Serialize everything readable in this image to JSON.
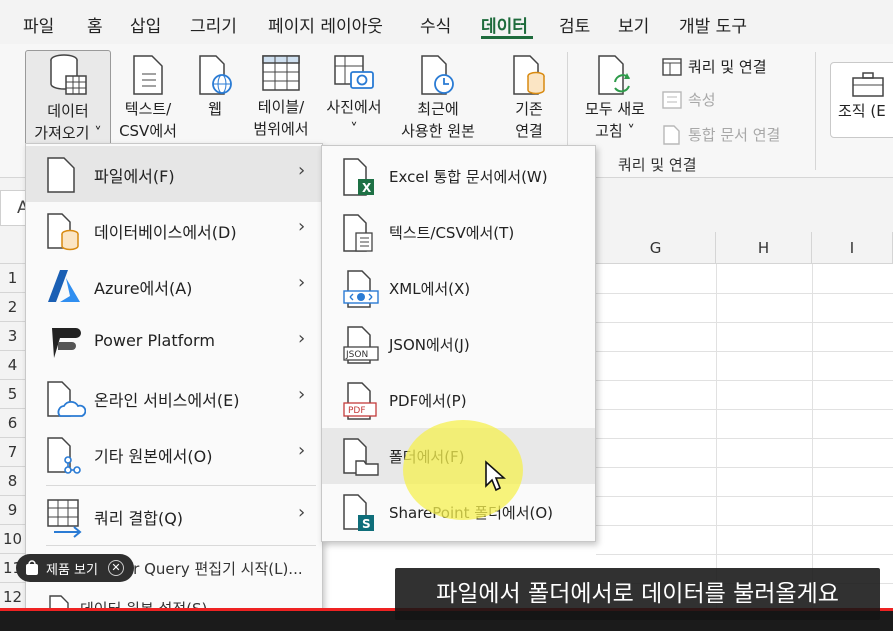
{
  "ribbon_tabs": [
    "파일",
    "홈",
    "삽입",
    "그리기",
    "페이지 레이아웃",
    "수식",
    "데이터",
    "검토",
    "보기",
    "개발 도구"
  ],
  "active_tab": "데이터",
  "ribbon": {
    "get_data": [
      "데이터",
      "가져오기 ˅"
    ],
    "text_csv": [
      "텍스트/",
      "CSV에서"
    ],
    "web": [
      "웹"
    ],
    "table_range": [
      "테이블/",
      "범위에서"
    ],
    "from_picture": [
      "사진에서",
      "˅"
    ],
    "recent_sources": [
      "최근에",
      "사용한 원본"
    ],
    "existing_connections": [
      "기존",
      "연결"
    ],
    "refresh_all": [
      "모두 새로",
      "고침 ˅"
    ],
    "queries_connections": "쿼리 및 연결",
    "properties": "속성",
    "edit_links": "통합 문서 연결",
    "group_queries": "쿼리 및 연결",
    "organize": "조직 (E"
  },
  "name_box": "A",
  "columns": [
    "G",
    "H",
    "I"
  ],
  "rows": [
    "1",
    "2",
    "3",
    "4",
    "5",
    "6",
    "7",
    "8",
    "9",
    "10",
    "11",
    "12"
  ],
  "menu": {
    "items": [
      {
        "label": "파일에서(F)",
        "icon": "file-icon"
      },
      {
        "label": "데이터베이스에서(D)",
        "icon": "database-icon"
      },
      {
        "label": "Azure에서(A)",
        "icon": "azure-icon"
      },
      {
        "label": "Power Platform",
        "icon": "power-platform-icon"
      },
      {
        "label": "온라인 서비스에서(E)",
        "icon": "cloud-file-icon"
      },
      {
        "label": "기타 원본에서(O)",
        "icon": "other-source-icon"
      },
      {
        "label": "쿼리 결합(Q)",
        "icon": "combine-query-icon"
      }
    ],
    "power_query": "Power Query 편집기 시작(L)...",
    "data_source": "데이터 원본 설정(S)..."
  },
  "submenu": {
    "items": [
      {
        "label": "Excel 통합 문서에서(W)",
        "icon": "excel-file-icon"
      },
      {
        "label": "텍스트/CSV에서(T)",
        "icon": "text-file-icon"
      },
      {
        "label": "XML에서(X)",
        "icon": "xml-file-icon"
      },
      {
        "label": "JSON에서(J)",
        "icon": "json-file-icon"
      },
      {
        "label": "PDF에서(P)",
        "icon": "pdf-file-icon"
      },
      {
        "label": "폴더에서(F)",
        "icon": "folder-icon"
      },
      {
        "label": "SharePoint 폴더에서(O)",
        "icon": "sharepoint-folder-icon"
      }
    ]
  },
  "overlay": {
    "product_pill": "제품 보기",
    "subtitle": "파일에서 폴더에서로 데이터를 불러올게요"
  },
  "colors": {
    "accent": "#1e6b3c",
    "highlight": "#f5f050",
    "progress": "#ee2222"
  }
}
